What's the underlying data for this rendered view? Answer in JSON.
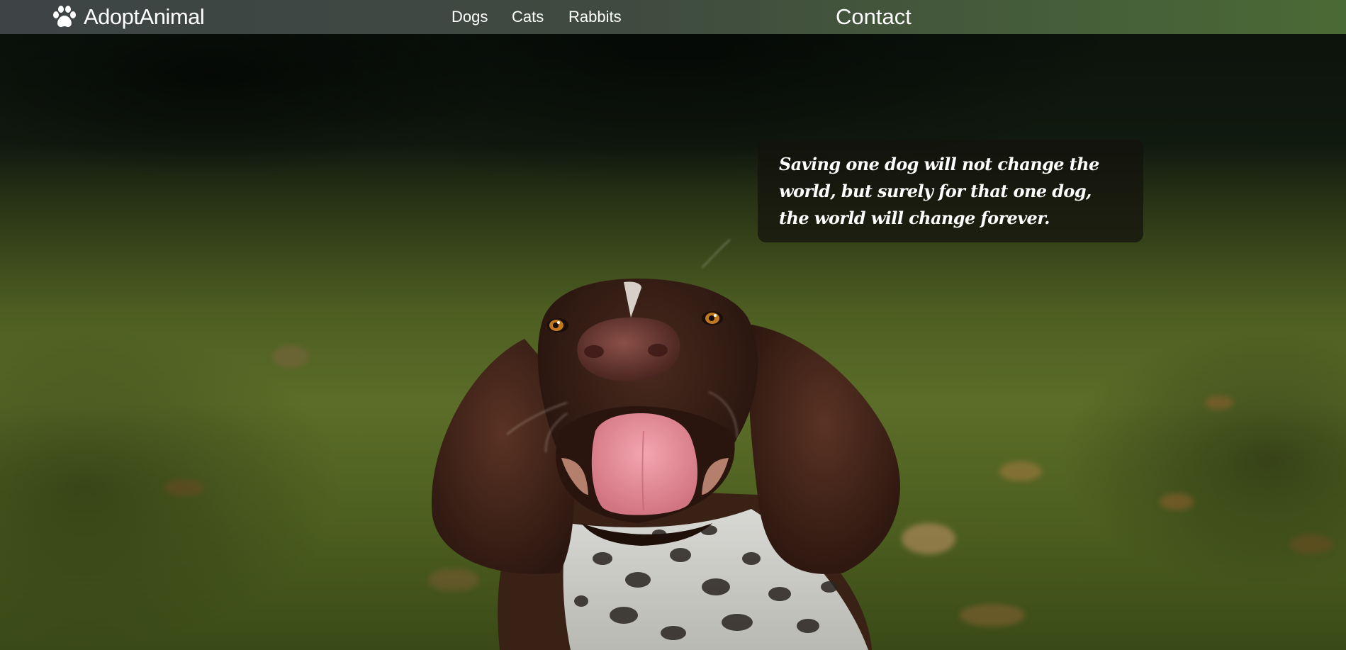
{
  "nav": {
    "brand_label": "AdoptAnimal",
    "brand_icon": "paw-icon",
    "links": [
      {
        "label": "Dogs"
      },
      {
        "label": "Cats"
      },
      {
        "label": "Rabbits"
      }
    ],
    "contact_label": "Contact"
  },
  "hero": {
    "quote": "Saving one dog will not change the world, but surely for that one dog, the world will change forever."
  },
  "colors": {
    "nav_start": "#3e4446",
    "nav_end": "#4a6a35",
    "quote_bg": "rgba(20,18,12,0.72)",
    "text": "#ffffff"
  }
}
